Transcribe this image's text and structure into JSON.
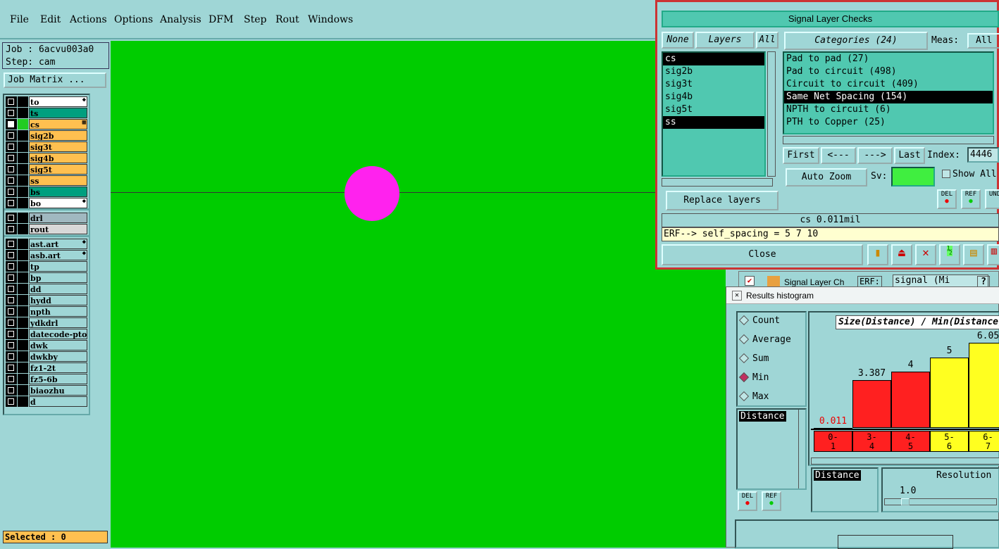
{
  "menubar": {
    "items": [
      "File",
      "Edit",
      "Actions",
      "Options",
      "Analysis",
      "DFM",
      "Step",
      "Rout",
      "Windows"
    ]
  },
  "left": {
    "job_label": "Job : 6acvu003a0",
    "step_label": "Step: cam",
    "job_matrix": "Job Matrix ...",
    "selected": "Selected : 0",
    "layers": [
      {
        "name": "to",
        "color": "#ffffff",
        "mark": "◆"
      },
      {
        "name": "ts",
        "color": "#009f7f",
        "mark": ""
      },
      {
        "name": "cs",
        "color": "#ffc050",
        "mark": "▦"
      },
      {
        "name": "sig2b",
        "color": "#ffc050",
        "mark": ""
      },
      {
        "name": "sig3t",
        "color": "#ffc050",
        "mark": ""
      },
      {
        "name": "sig4b",
        "color": "#ffc050",
        "mark": ""
      },
      {
        "name": "sig5t",
        "color": "#ffc050",
        "mark": ""
      },
      {
        "name": "ss",
        "color": "#ffc050",
        "mark": ""
      },
      {
        "name": "bs",
        "color": "#009f7f",
        "mark": ""
      },
      {
        "name": "bo",
        "color": "#ffffff",
        "mark": "◆"
      },
      {
        "name": "drl",
        "color": "#a0b8c0",
        "mark": ""
      },
      {
        "name": "rout",
        "color": "#d8d8d8",
        "mark": ""
      },
      {
        "name": "ast.art",
        "color": "#9fd6d6",
        "mark": "◆"
      },
      {
        "name": "asb.art",
        "color": "#9fd6d6",
        "mark": "◆"
      },
      {
        "name": "tp",
        "color": "#9fd6d6",
        "mark": ""
      },
      {
        "name": "bp",
        "color": "#9fd6d6",
        "mark": ""
      },
      {
        "name": "dd",
        "color": "#9fd6d6",
        "mark": ""
      },
      {
        "name": "hydd",
        "color": "#9fd6d6",
        "mark": ""
      },
      {
        "name": "npth",
        "color": "#9fd6d6",
        "mark": ""
      },
      {
        "name": "ydkdrl",
        "color": "#9fd6d6",
        "mark": ""
      },
      {
        "name": "datecode-pto",
        "color": "#9fd6d6",
        "mark": ""
      },
      {
        "name": "dwk",
        "color": "#9fd6d6",
        "mark": ""
      },
      {
        "name": "dwkby",
        "color": "#9fd6d6",
        "mark": ""
      },
      {
        "name": "fz1-2t",
        "color": "#9fd6d6",
        "mark": ""
      },
      {
        "name": "fz5-6b",
        "color": "#9fd6d6",
        "mark": ""
      },
      {
        "name": "biaozhu",
        "color": "#9fd6d6",
        "mark": ""
      },
      {
        "name": "d",
        "color": "#9fd6d6",
        "mark": ""
      }
    ]
  },
  "dialog": {
    "title": "Signal Layer Checks",
    "none_btn": "None",
    "layers_btn": "Layers",
    "all_btn": "All",
    "categories_btn": "Categories (24)",
    "meas_label": "Meas:",
    "meas_value": "All",
    "layer_list": [
      "cs",
      "sig2b",
      "sig3t",
      "sig4b",
      "sig5t",
      "ss"
    ],
    "categories": [
      "Pad to pad (27)",
      "Pad to circuit (498)",
      "Circuit to circuit (409)",
      "Same Net Spacing (154)",
      "NPTH to circuit (6)",
      "PTH to Copper (25)"
    ],
    "first_btn": "First",
    "prev_btn": "<---",
    "next_btn": "--->",
    "last_btn": "Last",
    "index_label": "Index:",
    "index_value": "4446",
    "autozoom_btn": "Auto Zoom",
    "sv_label": "Sv:",
    "show_all": "Show All",
    "replace_layers": "Replace layers",
    "del_label": "DEL",
    "ref_label": "REF",
    "und_label": "UND",
    "info": "cs 0.011mil",
    "erf": "ERF--> self_spacing = 5 7 10",
    "close_btn": "Close"
  },
  "behind": {
    "title": "Signal Layer Ch",
    "erf": "ERF:",
    "signal": "signal (Mi",
    "help": "?"
  },
  "histogram": {
    "title": "Results histogram",
    "modes": [
      "Count",
      "Average",
      "Sum",
      "Min",
      "Max"
    ],
    "selected_mode": "Min",
    "list_header": "Distance",
    "chart_title": "Size(Distance) / Min(Distance)",
    "resolution_label": "Resolution",
    "resolution_value": "1.0",
    "distance_label": "Distance",
    "del_label": "DEL",
    "ref_label": "REF"
  },
  "chart_data": {
    "type": "bar",
    "title": "Size(Distance) / Min(Distance)",
    "categories": [
      "0-1",
      "3-4",
      "4-5",
      "5-6",
      "6-7"
    ],
    "values": [
      0.011,
      3.387,
      4,
      5,
      6.05
    ],
    "value_labels": [
      "0.011",
      "3.387",
      "4",
      "5",
      "6.05"
    ],
    "colors": [
      "#ff2020",
      "#ff2020",
      "#ff2020",
      "#ffff20",
      "#ffff20"
    ],
    "ylim": [
      0,
      7
    ]
  }
}
